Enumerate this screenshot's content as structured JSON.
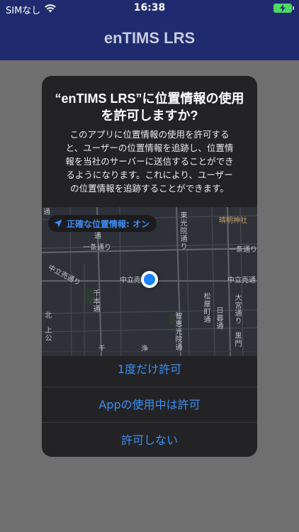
{
  "status_bar": {
    "carrier": "SIMなし",
    "time": "16:38",
    "battery_color": "#4cd964"
  },
  "nav": {
    "title": "enTIMS LRS"
  },
  "alert": {
    "title_line1": "“enTIMS LRS”に位置情報の使用",
    "title_line2": "を許可しますか?",
    "message_lines": [
      "このアプリに位置情報の使用を許可する",
      "と、ユーザーの位置情報を追跡し、位置情",
      "報を当社のサーバーに送信することができ",
      "るようになります。これにより、ユーザー",
      "の位置情報を追跡することができます。"
    ],
    "precise_location_label": "正確な位置情報: オン",
    "buttons": {
      "allow_once": "1度だけ許可",
      "allow_while_using": "Appの使用中は許可",
      "dont_allow": "許可しない"
    },
    "accent_color": "#3d8ff5"
  },
  "map": {
    "labels": {
      "shrine": "晴明神社",
      "ichijo_right": "一条通り",
      "ichijo_left": "一条通り",
      "nakadachiuri_left": "中立売通り",
      "nakadachiuri_center": "中立売",
      "nakadachiuri_right": "中立売通",
      "higashi_koin": "東光院通り",
      "tori_top": "通",
      "senbon": "千本通",
      "matsuya": "松屋町通",
      "higurashi": "日暮通",
      "omiya": "大宮通り",
      "kuromon": "黒門",
      "chie_koin": "智恵光院通",
      "ura": "浄",
      "sen": "千",
      "kita": "北",
      "left_edge": "上公",
      "top_left": "通"
    }
  }
}
